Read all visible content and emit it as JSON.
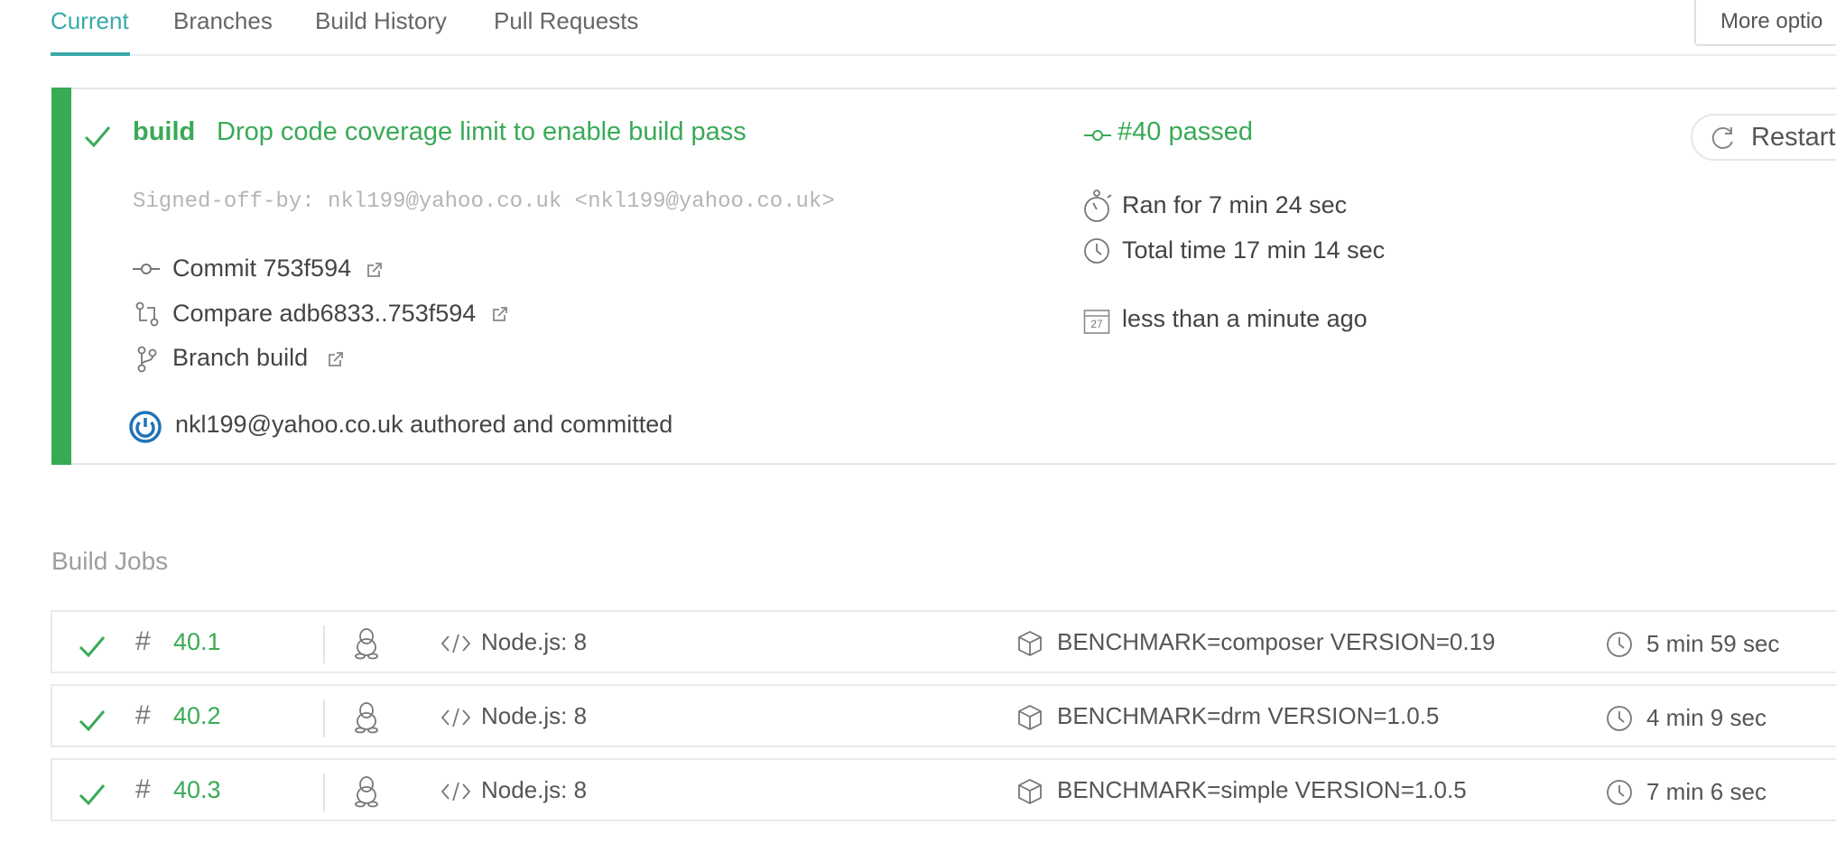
{
  "tabs": [
    {
      "label": "Current",
      "active": true
    },
    {
      "label": "Branches",
      "active": false
    },
    {
      "label": "Build History",
      "active": false
    },
    {
      "label": "Pull Requests",
      "active": false
    }
  ],
  "more_options_label": "More optio",
  "build": {
    "branch": "build",
    "message": "Drop code coverage limit to enable build pass",
    "signoff": "Signed-off-by: nkl199@yahoo.co.uk <nkl199@yahoo.co.uk>",
    "commit": "Commit 753f594",
    "compare": "Compare adb6833..753f594",
    "branch_link": "Branch build",
    "author": "nkl199@yahoo.co.uk authored and committed",
    "status": "#40 passed",
    "ran_for": "Ran for 7 min 24 sec",
    "total_time": "Total time 17 min 14 sec",
    "finished": "less than a minute ago",
    "calendar_day": "27",
    "restart_label": "Restart"
  },
  "jobs_title": "Build Jobs",
  "jobs": [
    {
      "number": "40.1",
      "language": "Node.js: 8",
      "env": "BENCHMARK=composer VERSION=0.19",
      "duration": "5 min 59 sec"
    },
    {
      "number": "40.2",
      "language": "Node.js: 8",
      "env": "BENCHMARK=drm VERSION=1.0.5",
      "duration": "4 min 9 sec"
    },
    {
      "number": "40.3",
      "language": "Node.js: 8",
      "env": "BENCHMARK=simple VERSION=1.0.5",
      "duration": "7 min 6 sec"
    }
  ],
  "colors": {
    "passed": "#39aa56",
    "accent": "#39aaaa"
  }
}
